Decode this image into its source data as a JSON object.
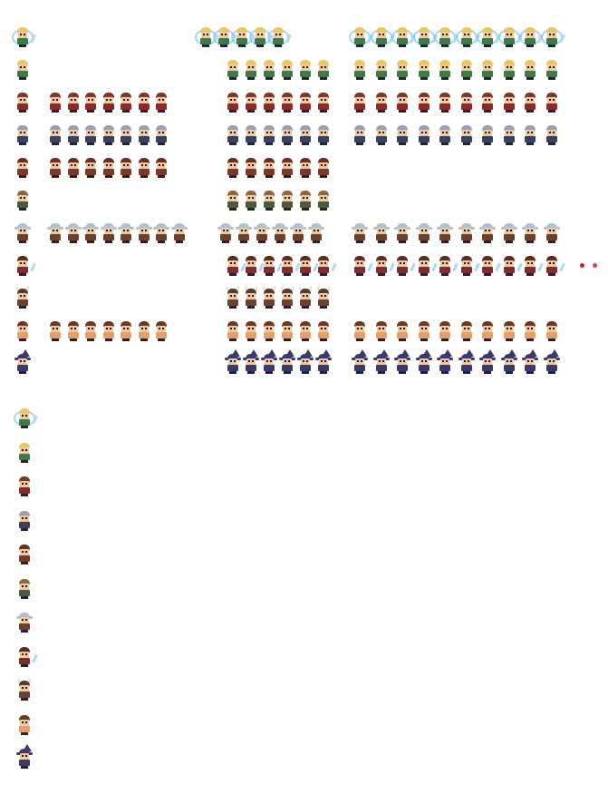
{
  "sheet": {
    "background": "#ffffff",
    "characters": [
      {
        "id": "elf_fx",
        "hair": "#e8c860",
        "body": "#3f7a4a",
        "variant": "fx"
      },
      {
        "id": "elf",
        "hair": "#e8c860",
        "body": "#3f7a4a",
        "variant": "plain"
      },
      {
        "id": "thief",
        "hair": "#7a3a2a",
        "body": "#8a2a2a",
        "variant": "plain"
      },
      {
        "id": "knight",
        "hair": "#9aa0b0",
        "body": "#3a4060",
        "variant": "plain"
      },
      {
        "id": "rogue",
        "hair": "#6a3020",
        "body": "#7a3a2a",
        "variant": "plain"
      },
      {
        "id": "ranger",
        "hair": "#8a6a3a",
        "body": "#4a5a3a",
        "variant": "plain"
      },
      {
        "id": "explorer",
        "hair": "#b0c0d0",
        "body": "#6a4030",
        "variant": "brim"
      },
      {
        "id": "bard",
        "hair": "#5a3020",
        "body": "#7a3030",
        "variant": "feather"
      },
      {
        "id": "viking",
        "hair": "#5a3a2a",
        "body": "#6a4030",
        "variant": "horns"
      },
      {
        "id": "barbarian",
        "hair": "#6a3a20",
        "body": "#e0a070",
        "variant": "plain"
      },
      {
        "id": "wizard",
        "hair": "#3c3a6a",
        "body": "#3c3a6a",
        "variant": "wizard"
      }
    ],
    "rows": [
      {
        "char": 0,
        "groups": [
          [
            0,
            1
          ]
        ],
        "extra": [
          [
            9,
            14
          ],
          [
            15,
            25
          ]
        ]
      },
      {
        "char": 1,
        "groups": [
          [
            0,
            1
          ]
        ],
        "extra": [
          [
            10,
            16
          ],
          [
            16,
            26
          ]
        ]
      },
      {
        "char": 2,
        "groups": [
          [
            0,
            1
          ],
          [
            2,
            9
          ]
        ],
        "extra": [
          [
            10,
            16
          ],
          [
            16,
            26
          ]
        ]
      },
      {
        "char": 3,
        "groups": [
          [
            0,
            1
          ],
          [
            2,
            9
          ]
        ],
        "extra": [
          [
            10,
            16
          ],
          [
            16,
            26
          ]
        ]
      },
      {
        "char": 4,
        "groups": [
          [
            0,
            1
          ],
          [
            2,
            9
          ]
        ],
        "extra": [
          [
            10,
            16
          ]
        ]
      },
      {
        "char": 5,
        "groups": [
          [
            0,
            1
          ]
        ],
        "extra": [
          [
            10,
            16
          ]
        ]
      },
      {
        "char": 6,
        "groups": [
          [
            0,
            1
          ],
          [
            2,
            10
          ]
        ],
        "extra": [
          [
            10,
            16
          ],
          [
            16,
            26
          ]
        ]
      },
      {
        "char": 7,
        "groups": [
          [
            0,
            1
          ]
        ],
        "extra": [
          [
            10,
            16
          ],
          [
            16,
            26
          ]
        ]
      },
      {
        "char": 8,
        "groups": [
          [
            0,
            1
          ]
        ],
        "extra": [
          [
            10,
            16
          ]
        ]
      },
      {
        "char": 9,
        "groups": [
          [
            0,
            1
          ],
          [
            2,
            9
          ]
        ],
        "extra": [
          [
            10,
            16
          ],
          [
            16,
            26
          ]
        ]
      },
      {
        "char": 10,
        "groups": [
          [
            0,
            1
          ]
        ],
        "extra": [
          [
            10,
            16
          ],
          [
            16,
            26
          ]
        ]
      }
    ],
    "column_icons": [
      0,
      1,
      2,
      3,
      4,
      5,
      6,
      7,
      8,
      9,
      10
    ],
    "projectile_colors": [
      "#c02828",
      "#d04848"
    ]
  }
}
